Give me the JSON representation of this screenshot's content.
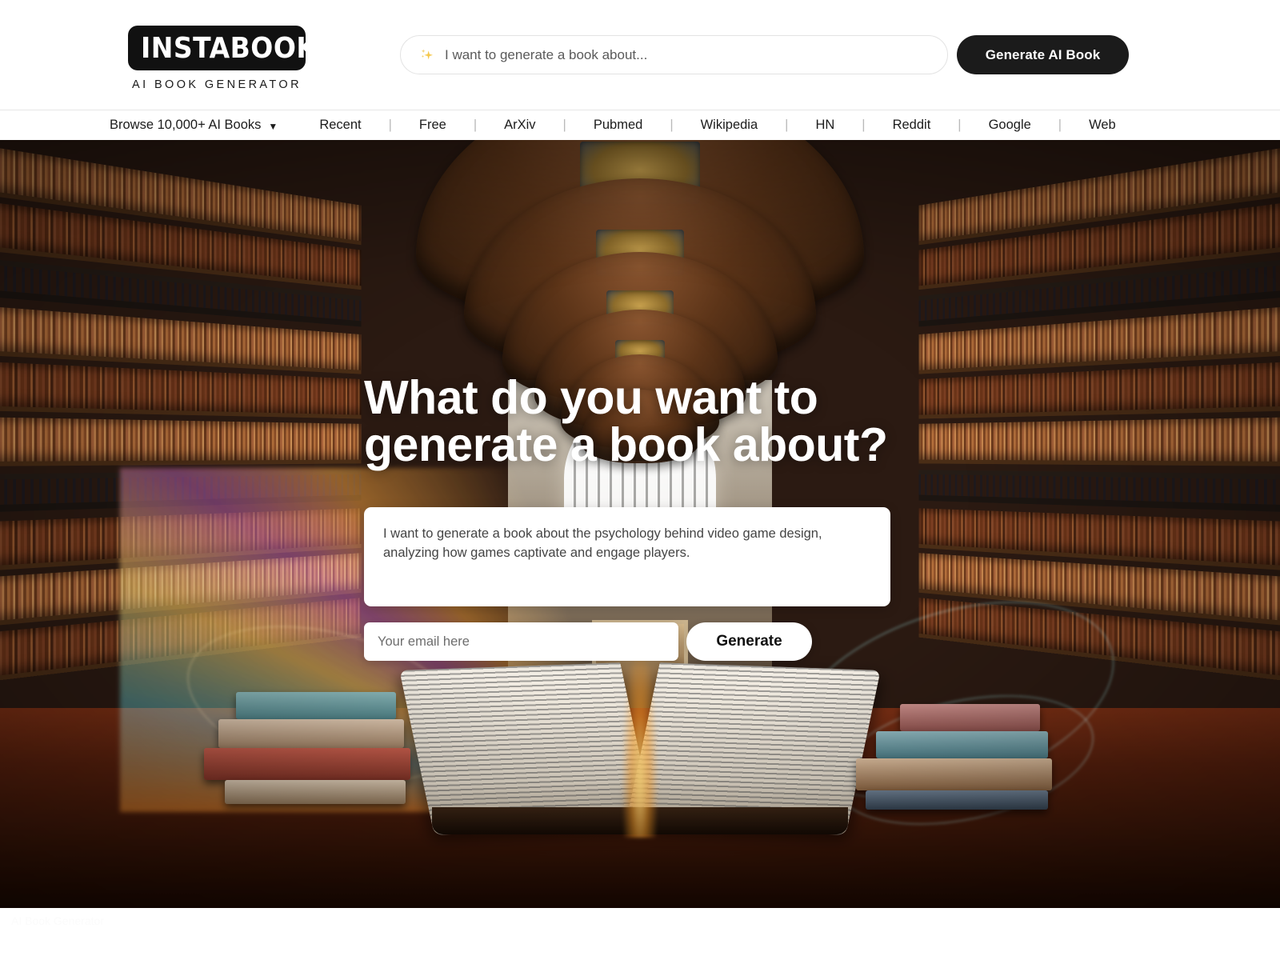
{
  "header": {
    "logo": {
      "mark_text": "INSTABOOKS",
      "tagline": "AI BOOK GENERATOR",
      "icon": "sparkle-icon"
    },
    "search": {
      "placeholder": "I want to generate a book about...",
      "value": "",
      "icon": "sparkle-icon"
    },
    "cta_label": "Generate AI Book"
  },
  "nav": {
    "browse_label": "Browse 10,000+ AI Books",
    "browse_caret": "▼",
    "separator": "|",
    "items": [
      {
        "label": "Recent"
      },
      {
        "label": "Free"
      },
      {
        "label": "ArXiv"
      },
      {
        "label": "Pubmed"
      },
      {
        "label": "Wikipedia"
      },
      {
        "label": "HN"
      },
      {
        "label": "Reddit"
      },
      {
        "label": "Google"
      },
      {
        "label": "Web"
      }
    ]
  },
  "hero": {
    "title_line1": "What do you want to",
    "title_line2": "generate a book about?",
    "prompt": {
      "value": "I want to generate a book about the psychology behind video game design, analyzing how games captivate and engage players.",
      "placeholder": "I want to generate a book about..."
    },
    "email": {
      "placeholder": "Your email here",
      "value": ""
    },
    "generate_label": "Generate"
  },
  "below_fold": {
    "text": "AI Book Generator"
  },
  "colors": {
    "brand_black": "#1b1b1b",
    "page_white": "#ffffff",
    "sparkle_gold": "#f5c84c",
    "nav_text": "#1c1c1c",
    "nav_separator": "#b9b9b9",
    "hero_title_white": "#ffffff",
    "input_text_gray": "#444444"
  }
}
